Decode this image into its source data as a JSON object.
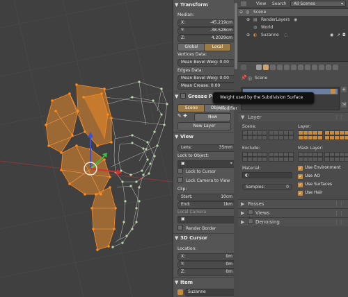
{
  "npanel": {
    "transform": {
      "title": "Transform",
      "median_label": "Median:",
      "x_key": "X:",
      "x_val": "-45.219cm",
      "y_key": "Y:",
      "y_val": "-38.528cm",
      "z_key": "Z:",
      "z_val": "4.2029cm",
      "global": "Global",
      "local": "Local",
      "vertices_label": "Vertices Data:",
      "mean_bevel_vert": "Mean Bevel Weig: 0.00",
      "edges_label": "Edges Data:",
      "mean_bevel_edge": "Mean Bevel Weig: 0.00",
      "mean_crease": "Mean Crease: 0.00"
    },
    "grease": {
      "title": "Grease Penci",
      "scene": "Scene",
      "object": "Object",
      "new": "New",
      "new_layer": "New Layer"
    },
    "view": {
      "title": "View",
      "lens_key": "Lens:",
      "lens_val": "35mm",
      "lock_object": "Lock to Object:",
      "lock_cursor": "Lock to Cursor",
      "lock_camera": "Lock Camera to View",
      "clip_label": "Clip:",
      "start_key": "Start:",
      "start_val": "10cm",
      "end_key": "End:",
      "end_val": "1km",
      "local_camera": "Local Camera",
      "render_border": "Render Border"
    },
    "cursor": {
      "title": "3D Cursor",
      "location_label": "Location:",
      "x_key": "X:",
      "x_val": "0m",
      "y_key": "Y:",
      "y_val": "0m",
      "z_key": "Z:",
      "z_val": "0m"
    },
    "item": {
      "title": "Item",
      "name": "Suzanne"
    }
  },
  "tooltip": "Weight used by the Subdivision Surface modifier",
  "outliner": {
    "view_menu": "View",
    "search_menu": "Search",
    "scenes_select": "All Scenes",
    "rows": [
      "Scene",
      "RenderLayers",
      "World",
      "Suzanne"
    ]
  },
  "props": {
    "breadcrumb": "Scene",
    "layer_title": "Layer",
    "scene_label": "Scene:",
    "layer_label": "Layer:",
    "exclude_label": "Exclude:",
    "mask_label": "Mask Layer:",
    "material_label": "Material:",
    "samples_key": "Samples:",
    "samples_val": "0",
    "use_environment": "Use Environment",
    "use_ao": "Use AO",
    "use_surfaces": "Use Surfaces",
    "use_hair": "Use Hair",
    "passes": "Passes",
    "views": "Views",
    "denoising": "Denoising"
  },
  "colors": {
    "accent": "#e8892a",
    "selected_vertex": "#ff8a1c",
    "unselected_vertex": "#b9d6a8",
    "panel_bg": "#555555"
  }
}
